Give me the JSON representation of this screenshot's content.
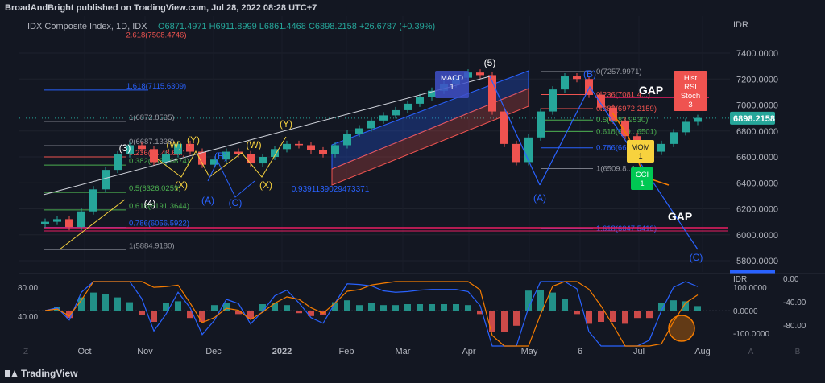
{
  "header": {
    "publisher": "BroadAndBright published on TradingView.com, Jul 28, 2022 08:28 UTC+7"
  },
  "footer": {
    "brand": "TradingView"
  },
  "legend": {
    "symbol": "IDX Composite Index, 1D, IDX",
    "ohlc": "O6871.4971 H6911.8999 L6861.4468 C6898.2158 +26.6787 (+0.39%)"
  },
  "chart_data": {
    "type": "candlestick",
    "currency": "IDR",
    "price_axis": {
      "min": 5800,
      "max": 7400,
      "ticks": [
        "7400.0000",
        "7200.0000",
        "7000.0000",
        "6800.0000",
        "6600.0000",
        "6400.0000",
        "6200.0000",
        "6000.0000",
        "5800.0000"
      ],
      "current_price": "6898.2158"
    },
    "time_axis": [
      "Oct",
      "Nov",
      "Dec",
      "2022",
      "Feb",
      "Mar",
      "Apr",
      "May",
      "6",
      "Jul",
      "Aug"
    ],
    "close_series": [
      6100,
      6120,
      6060,
      6180,
      6350,
      6500,
      6620,
      6690,
      6660,
      6560,
      6620,
      6700,
      6640,
      6540,
      6580,
      6640,
      6620,
      6550,
      6600,
      6660,
      6700,
      6690,
      6650,
      6620,
      6690,
      6780,
      6820,
      6880,
      6920,
      6960,
      7010,
      7060,
      7110,
      7160,
      7210,
      7250,
      7230,
      6950,
      6700,
      6560,
      6750,
      6950,
      7120,
      7220,
      7200,
      7080,
      6980,
      6880,
      6760,
      6700,
      6640,
      6700,
      6790,
      6870,
      6900
    ],
    "fib_left": [
      {
        "label": "2.618(7508.4746)",
        "price": 7508.4746
      },
      {
        "label": "1.618(7115.6309)",
        "price": 7115.6309
      },
      {
        "label": "1(6872.8535)",
        "price": 6872.8535
      },
      {
        "label": "0(6687.1338)",
        "price": 6687.1338
      },
      {
        "label": "0.236(6...48.6...)",
        "price": 6600
      },
      {
        "label": "0.382(6380.6874)",
        "price": 6537
      },
      {
        "label": "0.5(6326.0259)",
        "price": 6326.0259
      },
      {
        "label": "0.618(6191.3644)",
        "price": 6191.3644
      },
      {
        "label": "0.786(6056.5922)",
        "price": 6056.5922
      },
      {
        "label": "1(5884.9180)",
        "price": 5884.918
      }
    ],
    "fib_right": [
      {
        "label": "0(7257.9971)",
        "price": 7257.9971
      },
      {
        "label": "0.236(7081.4...)",
        "price": 7081
      },
      {
        "label": "0.382(6972.2159)",
        "price": 6972.2159
      },
      {
        "label": "0.5(6883.9530)",
        "price": 6883.953
      },
      {
        "label": "0.618(679...6501)",
        "price": 6796
      },
      {
        "label": "0.786(66...)",
        "price": 6670
      },
      {
        "label": "1(6509.8...)",
        "price": 6509.8
      },
      {
        "label": "1.618(6047.5419)",
        "price": 6047.5419
      }
    ],
    "wave_labels": [
      "(3)",
      "(4)",
      "(5)",
      "(A)",
      "(B)",
      "(C)",
      "(W)",
      "(X)",
      "(Y)"
    ],
    "annotations": {
      "gap_top": "GAP",
      "gap_bottom": "GAP",
      "channel_value": "0.9391139029473371",
      "macd_box": "MACD\n1",
      "hist_box": "Hist\nRSI\nStoch\n3",
      "mom_box": "MOM\n1",
      "cci_box": "CCI\n1"
    },
    "macd_axis": [
      "80.00",
      "40.00"
    ],
    "osc_axis": {
      "currency": "IDR",
      "ticks": [
        "100.0000",
        "0.0000",
        "-100.0000"
      ]
    },
    "rsi_axis": [
      "0.00",
      "-40.00",
      "-80.00"
    ],
    "bottom_buttons": [
      "Z",
      "A",
      "B"
    ],
    "colors": {
      "up": "#26a69a",
      "down": "#ef5350",
      "background": "#131722",
      "grid": "#1e222d",
      "text": "#b2b5be",
      "yellow": "#f7d23e",
      "blue": "#2962ff"
    }
  }
}
